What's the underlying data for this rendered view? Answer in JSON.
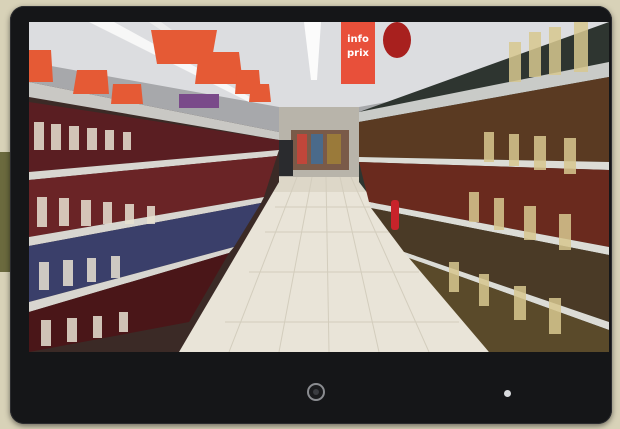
{
  "scene": {
    "sign_line1": "info",
    "sign_line2": "prix"
  },
  "colors": {
    "bezel": "#151618",
    "sign": "#e8503a",
    "lamp": "#e55a35",
    "floor": "#e9e4d8"
  },
  "icons": {
    "home": "home-button-icon",
    "indicator": "indicator-light-icon"
  }
}
